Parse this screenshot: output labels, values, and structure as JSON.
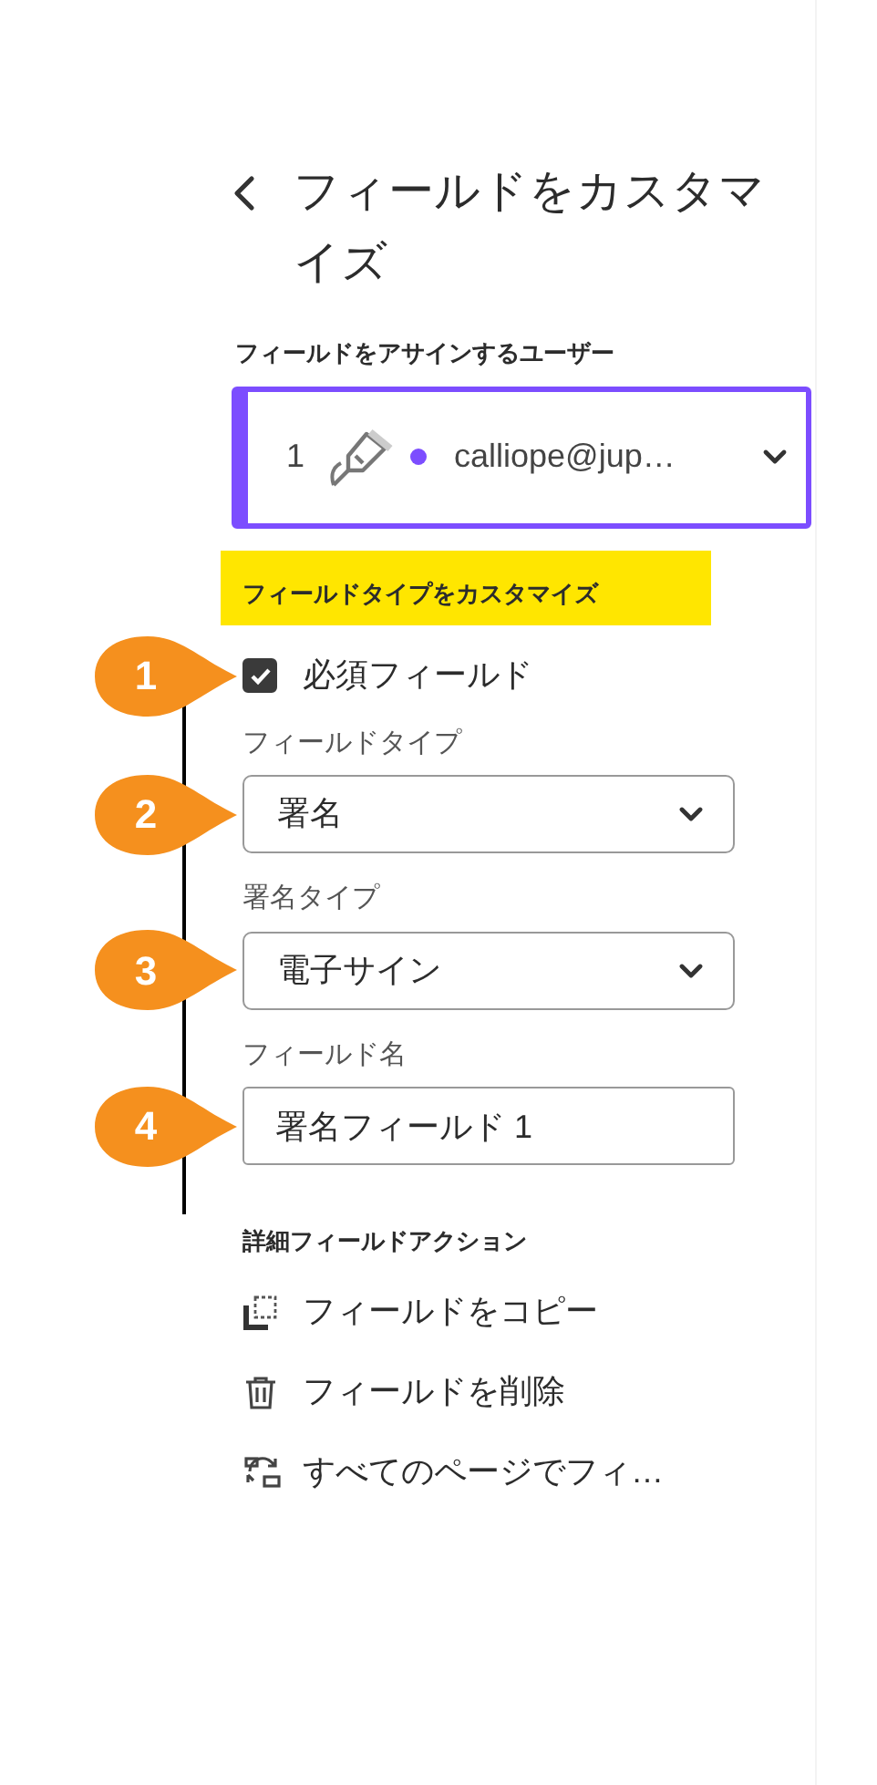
{
  "header": {
    "title": "フィールドをカスタマイズ"
  },
  "assignee": {
    "label": "フィールドをアサインするユーザー",
    "number": "1",
    "email": "calliope@jup…",
    "color": "#7c4dff"
  },
  "customize": {
    "heading": "フィールドタイプをカスタマイズ",
    "controls": [
      {
        "kind": "checkbox",
        "label": "必須フィールド",
        "checked": true,
        "callout": "1"
      },
      {
        "kind": "select",
        "label": "フィールドタイプ",
        "value": "署名",
        "callout": "2"
      },
      {
        "kind": "select",
        "label": "署名タイプ",
        "value": "電子サイン",
        "callout": "3"
      },
      {
        "kind": "text",
        "label": "フィールド名",
        "value": "署名フィールド 1",
        "callout": "4"
      }
    ]
  },
  "actions": {
    "heading": "詳細フィールドアクション",
    "items": [
      {
        "kind": "copy",
        "label": "フィールドをコピー"
      },
      {
        "kind": "delete",
        "label": "フィールドを削除"
      },
      {
        "kind": "sync",
        "label": "すべてのページでフィ…"
      }
    ]
  }
}
